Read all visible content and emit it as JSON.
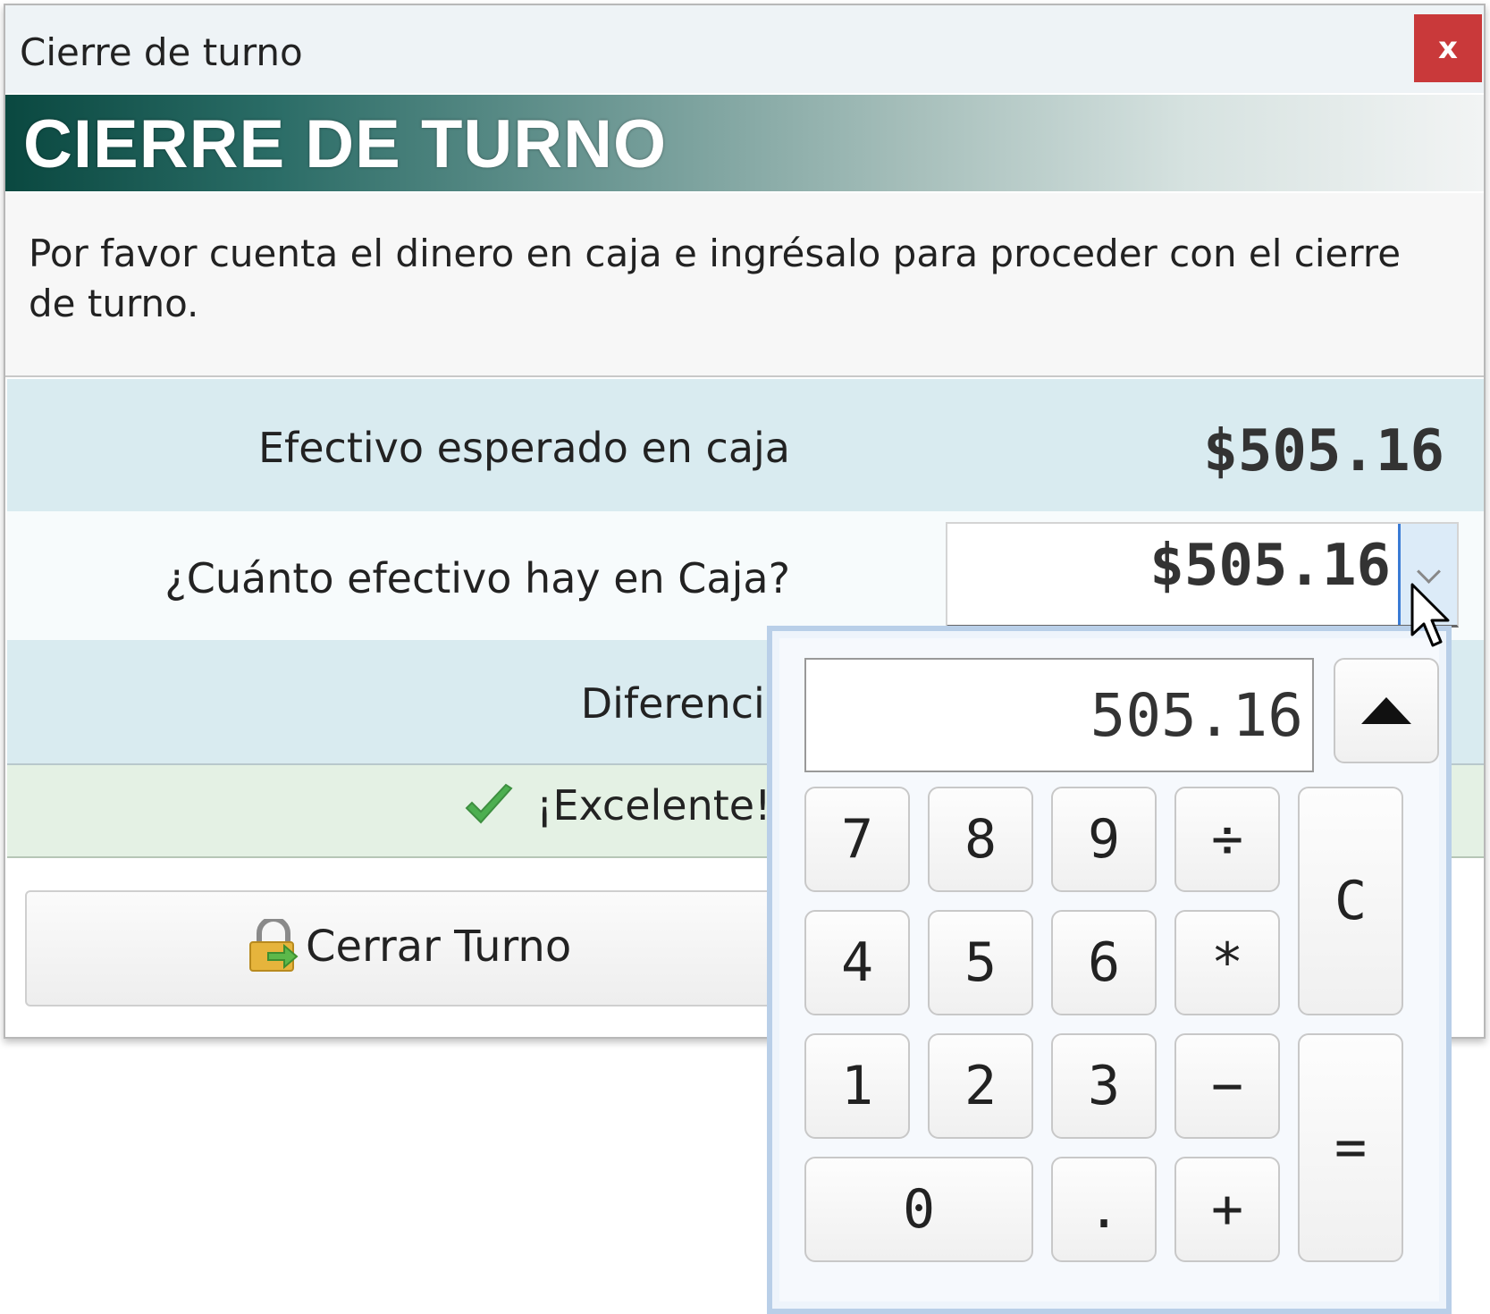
{
  "window": {
    "title": "Cierre de turno",
    "close_label": "x"
  },
  "banner": {
    "title": "CIERRE DE TURNO"
  },
  "instructions": "Por favor cuenta el dinero en caja e ingrésalo para proceder con el cierre de turno.",
  "expected": {
    "label": "Efectivo esperado en caja",
    "value": "$505.16"
  },
  "count": {
    "label": "¿Cuánto efectivo hay en Caja?",
    "value": "$505.16"
  },
  "difference": {
    "label": "Diferencia"
  },
  "status": {
    "text": "¡Excelente!",
    "icon": "check-icon",
    "color": "#4caf50"
  },
  "close_shift_button": {
    "label": "Cerrar Turno",
    "icon": "lock-exit-icon"
  },
  "calculator": {
    "display": "505.16",
    "keys": {
      "k7": "7",
      "k8": "8",
      "k9": "9",
      "div": "÷",
      "k4": "4",
      "k5": "5",
      "k6": "6",
      "mul": "*",
      "k1": "1",
      "k2": "2",
      "k3": "3",
      "sub": "−",
      "k0": "0",
      "dot": ".",
      "add": "+",
      "clear": "C",
      "equals": "="
    },
    "collapse_icon": "triangle-up-icon"
  },
  "colors": {
    "banner_dark": "#0a4840",
    "close_red": "#c9393a",
    "row_blue": "#d9ebf0",
    "status_green": "#e4f1e4"
  }
}
